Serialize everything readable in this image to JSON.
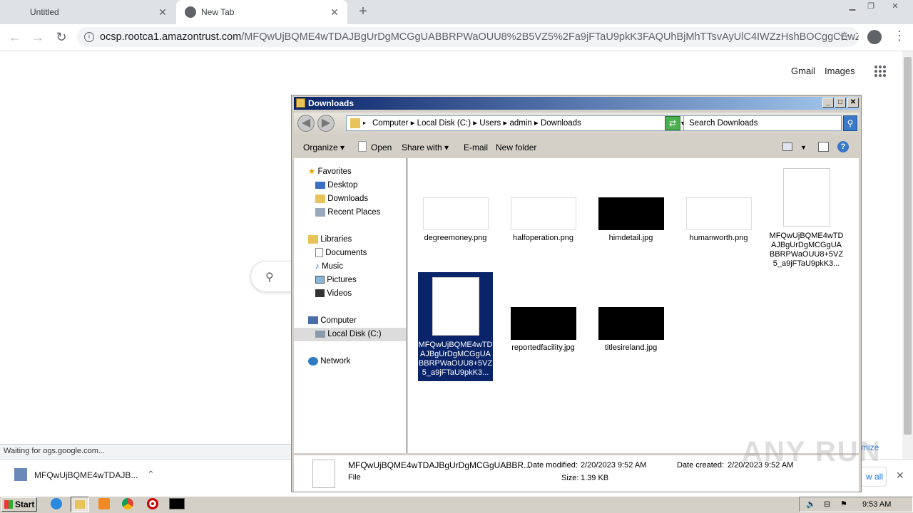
{
  "browser": {
    "tabs": [
      {
        "label": "Untitled"
      },
      {
        "label": "New Tab"
      }
    ],
    "url_host": "ocsp.rootca1.amazontrust.com",
    "url_rest": "/MFQwUjBQME4wTDAJBgUrDgMCGgUABBRPWaOUU8%2B5VZ5%2Fa9jFTaU9pkK3FAQUhBjMhTTsvAyUlC4IWZzHshBOCggCEwZ%2...",
    "status": "Waiting for ogs.google.com...",
    "download_name": "MFQwUjBQME4wTDAJB...",
    "shelf_partial": "mize",
    "shelf_show_all": "w all"
  },
  "google": {
    "gmail": "Gmail",
    "images": "Images"
  },
  "explorer": {
    "title": "Downloads",
    "breadcrumb": [
      "Computer",
      "Local Disk (C:)",
      "Users",
      "admin",
      "Downloads"
    ],
    "search_placeholder": "Search Downloads",
    "commands": {
      "organize": "Organize",
      "open": "Open",
      "share": "Share with",
      "email": "E-mail",
      "newfolder": "New folder"
    },
    "nav": {
      "favorites": "Favorites",
      "desktop": "Desktop",
      "downloads": "Downloads",
      "recent": "Recent Places",
      "libraries": "Libraries",
      "documents": "Documents",
      "music": "Music",
      "pictures": "Pictures",
      "videos": "Videos",
      "computer": "Computer",
      "localdisk": "Local Disk (C:)",
      "network": "Network"
    },
    "files": [
      {
        "name": "degreemoney.png",
        "kind": "light"
      },
      {
        "name": "halfoperation.png",
        "kind": "light"
      },
      {
        "name": "himdetail.jpg",
        "kind": "dark"
      },
      {
        "name": "humanworth.png",
        "kind": "light"
      },
      {
        "name": "MFQwUjBQME4wTDAJBgUrDgMCGgUABBRPWaOUU8+5VZ5_a9jFTaU9pkK3...",
        "kind": "doc"
      },
      {
        "name": "MFQwUjBQME4wTDAJBgUrDgMCGgUABBRPWaOUU8+5VZ5_a9jFTaU9pkK3...",
        "kind": "doc-selected"
      },
      {
        "name": "reportedfacility.jpg",
        "kind": "dark"
      },
      {
        "name": "titlesireland.jpg",
        "kind": "dark"
      }
    ],
    "details": {
      "name": "MFQwUjBQME4wTDAJBgUrDgMCGgUABBR...",
      "type": "File",
      "modified_label": "Date modified:",
      "modified": "2/20/2023 9:52 AM",
      "size_label": "Size:",
      "size": "1.39 KB",
      "created_label": "Date created:",
      "created": "2/20/2023 9:52 AM"
    }
  },
  "taskbar": {
    "start": "Start",
    "clock": "9:53 AM"
  },
  "watermark": "ANY RUN"
}
